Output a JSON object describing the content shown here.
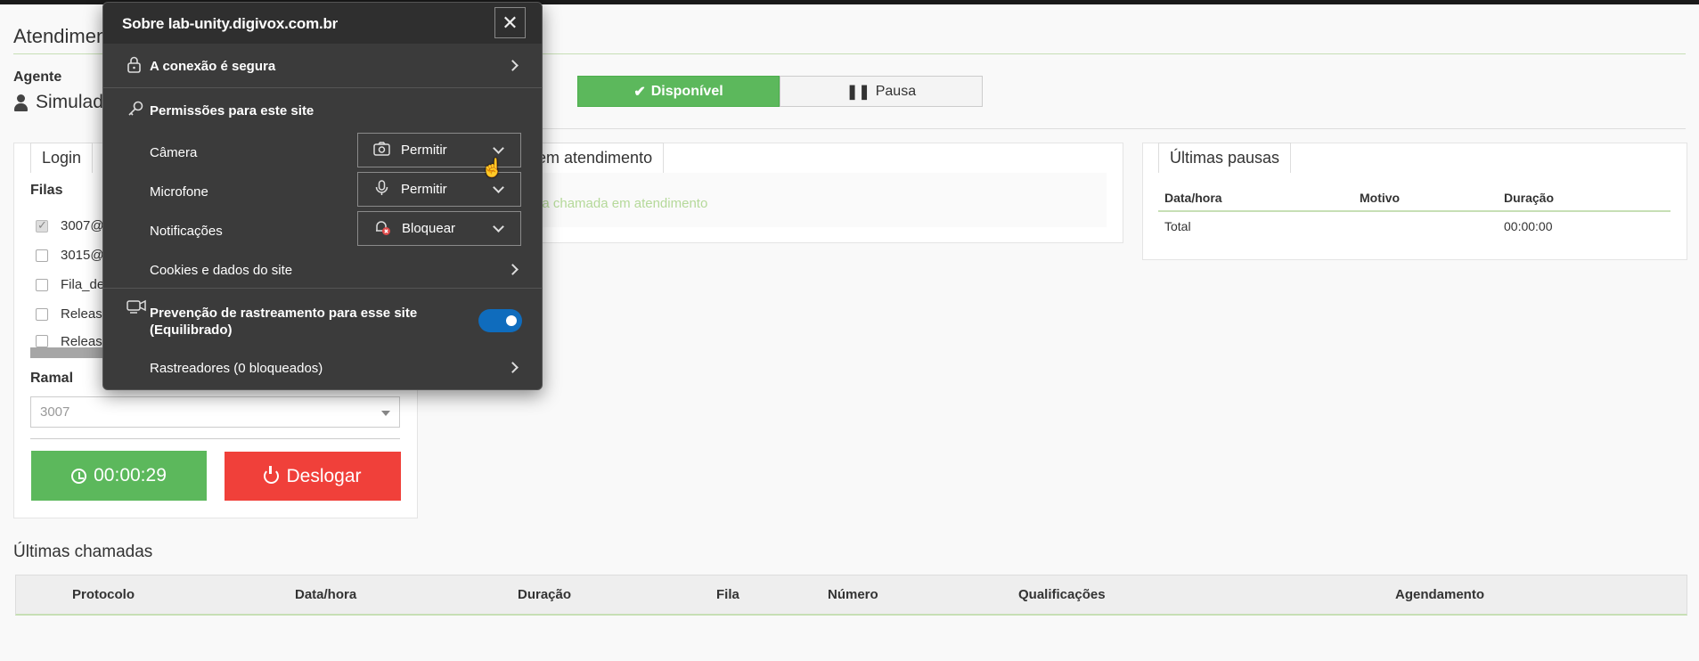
{
  "page": {
    "title": "Atendimento",
    "agent_label": "Agente",
    "agent_name": "Simulador"
  },
  "status": {
    "available_label": "Disponível",
    "pause_label": "Pausa"
  },
  "login_panel": {
    "tab": "Login",
    "queues_label": "Filas",
    "queues": [
      "3007@",
      "3015@",
      "Fila_de",
      "Releas",
      "Releas"
    ],
    "extension_label": "Ramal",
    "extension_value": "3007",
    "timer": "00:00:29",
    "logout_label": "Deslogar"
  },
  "call_panel": {
    "tab": "em atendimento",
    "empty_text": "na chamada em atendimento"
  },
  "pauses_panel": {
    "tab": "Últimas pausas",
    "headers": [
      "Data/hora",
      "Motivo",
      "Duração"
    ],
    "total_label": "Total",
    "total_value": "00:00:00"
  },
  "last_calls": {
    "title": "Últimas chamadas",
    "headers": [
      "Protocolo",
      "Data/hora",
      "Duração",
      "Fila",
      "Número",
      "Qualificações",
      "Agendamento"
    ]
  },
  "site_popup": {
    "title": "Sobre lab-unity.digivox.com.br",
    "connection": "A conexão é segura",
    "permissions_title": "Permissões para este site",
    "camera_label": "Câmera",
    "camera_value": "Permitir",
    "microphone_label": "Microfone",
    "microphone_value": "Permitir",
    "notifications_label": "Notificações",
    "notifications_value": "Bloquear",
    "cookies": "Cookies e dados do site",
    "tracking_line1": "Prevenção de rastreamento para esse site",
    "tracking_line2": "(Equilibrado)",
    "trackers": "Rastreadores (0 bloqueados)",
    "close_symbol": "✕"
  }
}
